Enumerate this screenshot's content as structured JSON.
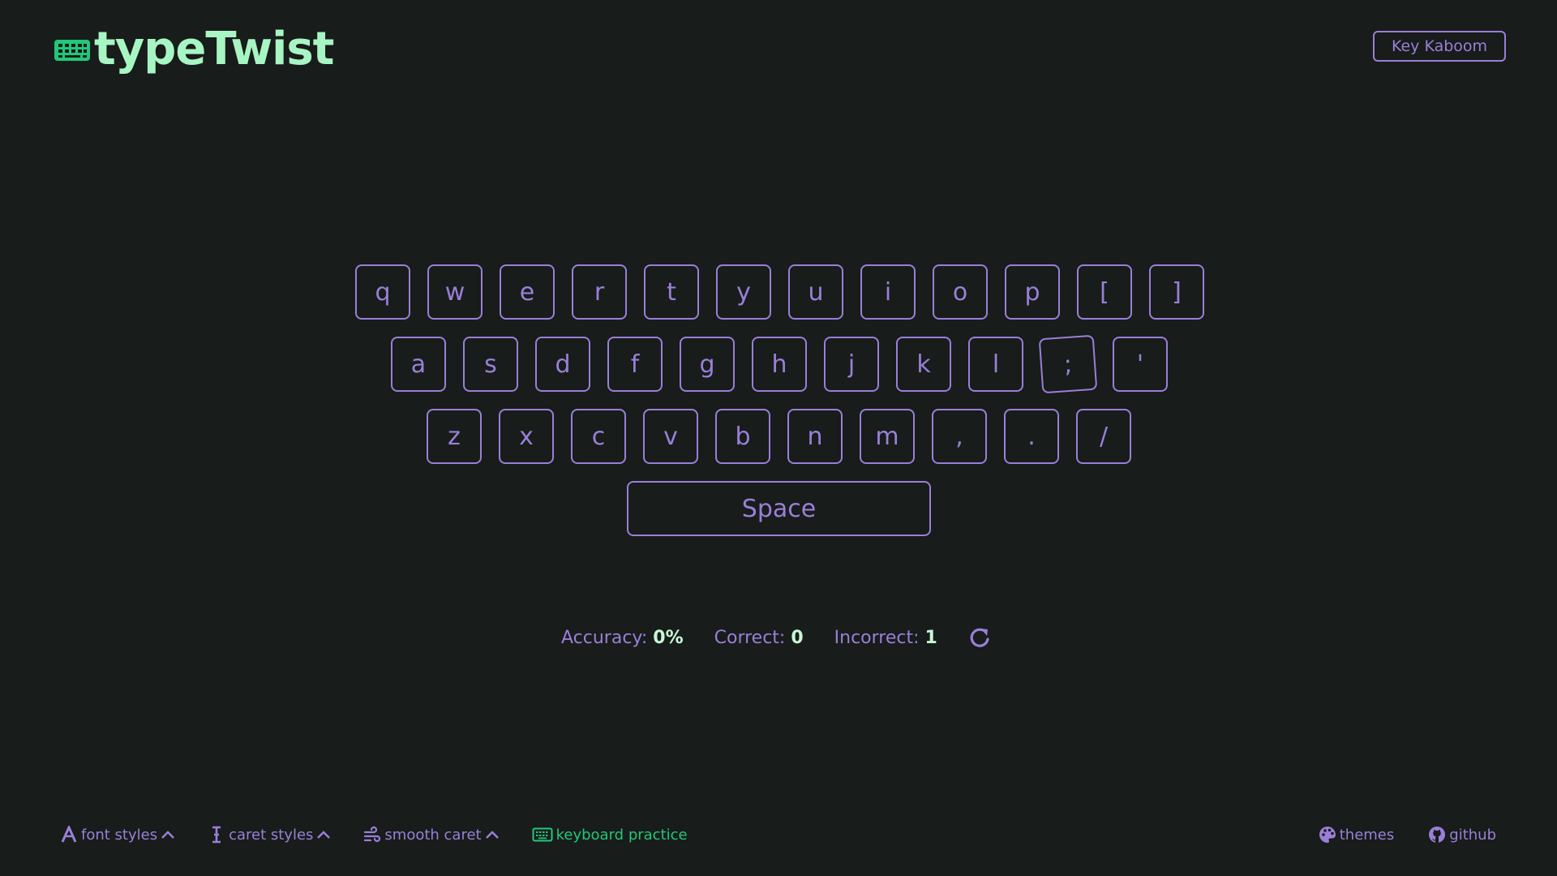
{
  "header": {
    "logo_text": "typeTwist",
    "logo_icon": "keyboard-icon",
    "mode_button": "Key Kaboom"
  },
  "keyboard": {
    "row1": [
      "q",
      "w",
      "e",
      "r",
      "t",
      "y",
      "u",
      "i",
      "o",
      "p",
      "[",
      "]"
    ],
    "row2": [
      "a",
      "s",
      "d",
      "f",
      "g",
      "h",
      "j",
      "k",
      "l",
      ";",
      "'"
    ],
    "row3": [
      "z",
      "x",
      "c",
      "v",
      "b",
      "n",
      "m",
      ",",
      ".",
      "/"
    ],
    "space": "Space"
  },
  "stats": {
    "accuracy_label": "Accuracy:",
    "accuracy_value": "0%",
    "correct_label": "Correct:",
    "correct_value": "0",
    "incorrect_label": "Incorrect:",
    "incorrect_value": "1",
    "restart_icon": "restart-icon"
  },
  "footer": {
    "left": [
      {
        "label": "font styles",
        "icon": "font-icon",
        "chevron": true
      },
      {
        "label": "caret styles",
        "icon": "text-cursor-icon",
        "chevron": true
      },
      {
        "label": "smooth caret",
        "icon": "wind-icon",
        "chevron": true
      },
      {
        "label": "keyboard practice",
        "icon": "keyboard-icon",
        "active": true
      }
    ],
    "right": [
      {
        "label": "themes",
        "icon": "palette-icon"
      },
      {
        "label": "github",
        "icon": "github-icon"
      }
    ]
  },
  "colors": {
    "background": "#181c1a",
    "accent_purple": "#9a7fd9",
    "logo_mint": "#a8f5c4",
    "active_green": "#22c77a",
    "stat_value": "#c6f8d8"
  }
}
